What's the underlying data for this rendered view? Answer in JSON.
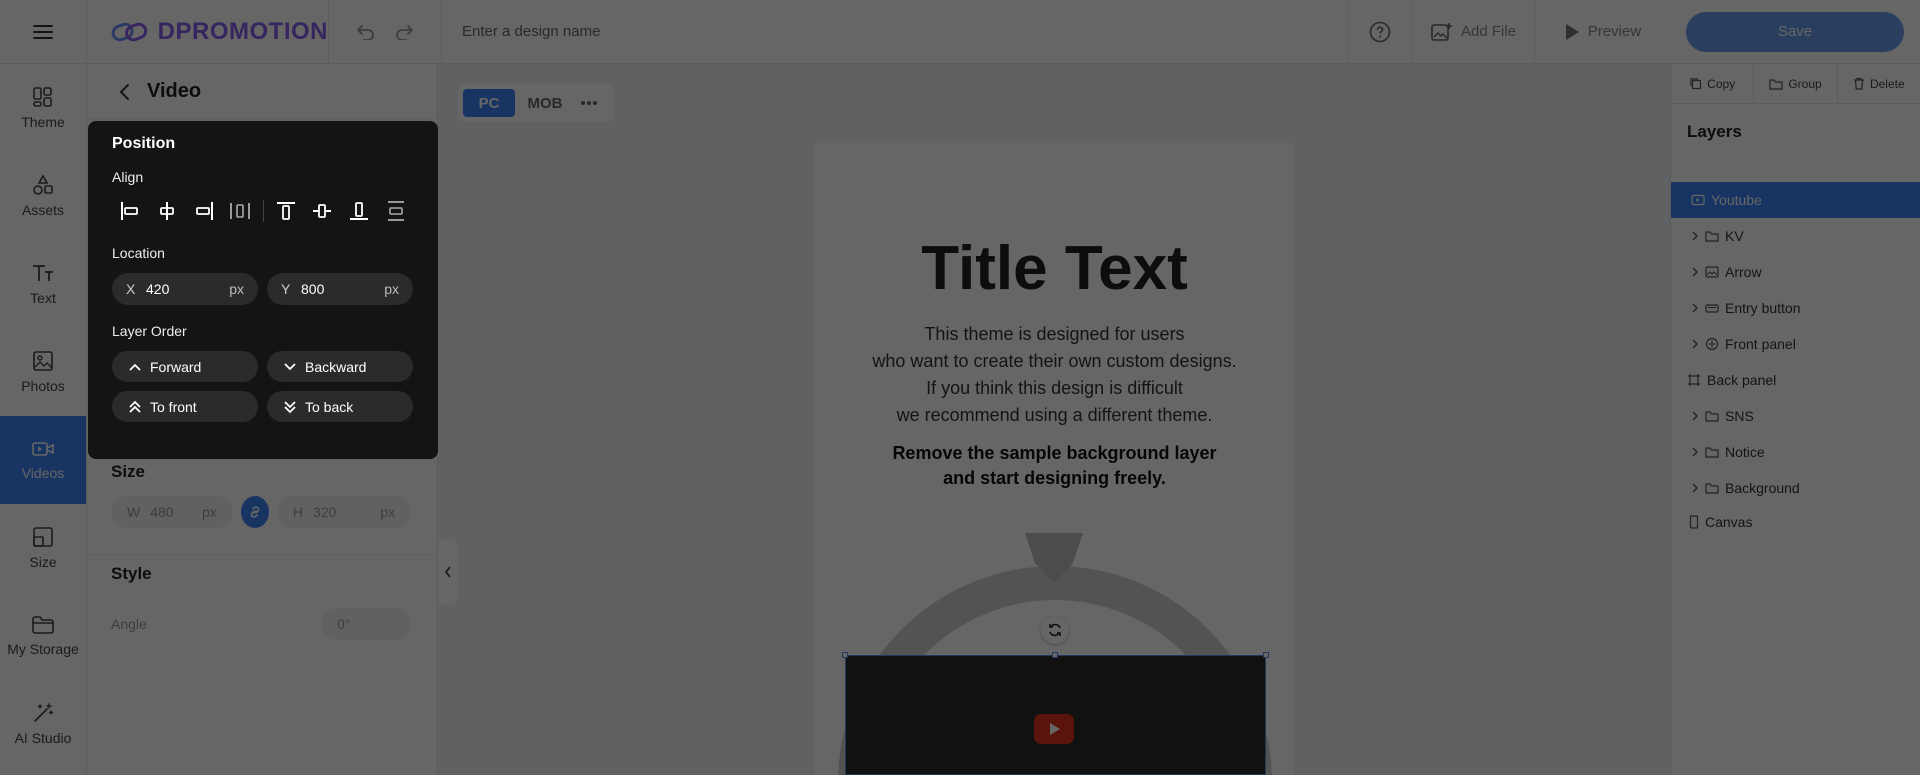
{
  "topbar": {
    "logo_text": "DPROMOTION",
    "design_name_placeholder": "Enter a design name",
    "add_file_label": "Add File",
    "preview_label": "Preview",
    "save_label": "Save"
  },
  "sidebar": {
    "items": [
      {
        "label": "Theme",
        "icon": "theme-icon"
      },
      {
        "label": "Assets",
        "icon": "assets-icon"
      },
      {
        "label": "Text",
        "icon": "text-icon"
      },
      {
        "label": "Photos",
        "icon": "photos-icon"
      },
      {
        "label": "Videos",
        "icon": "videos-icon",
        "active": true
      },
      {
        "label": "Size",
        "icon": "size-icon"
      },
      {
        "label": "My Storage",
        "icon": "folder-icon"
      },
      {
        "label": "AI Studio",
        "icon": "magic-wand-icon"
      }
    ]
  },
  "panel": {
    "title": "Video",
    "position": {
      "title": "Position",
      "align_label": "Align",
      "location_label": "Location",
      "x_axis": "X",
      "x_value": "420",
      "y_axis": "Y",
      "y_value": "800",
      "unit": "px",
      "layer_order_label": "Layer Order",
      "forward": "Forward",
      "backward": "Backward",
      "to_front": "To front",
      "to_back": "To back"
    },
    "size": {
      "title": "Size",
      "w_axis": "W",
      "w_value": "480",
      "h_axis": "H",
      "h_value": "320",
      "unit": "px"
    },
    "style": {
      "title": "Style",
      "angle_label": "Angle",
      "angle_value": "0°"
    }
  },
  "canvas": {
    "tabs": [
      "PC",
      "MOB"
    ],
    "active_tab": "PC",
    "title_text": "Title Text",
    "desc_lines": [
      "This theme is designed for users",
      "who want to create their own custom designs.",
      "If you think this design is difficult",
      "we recommend using a different theme."
    ],
    "bold_lines": [
      "Remove the sample background layer",
      "and start designing freely."
    ]
  },
  "right_panel": {
    "copy_label": "Copy",
    "group_label": "Group",
    "delete_label": "Delete",
    "layers_title": "Layers",
    "layers": [
      {
        "name": "Youtube",
        "icon": "video-icon",
        "active": true,
        "expandable": false
      },
      {
        "name": "KV",
        "icon": "folder-icon",
        "expandable": true
      },
      {
        "name": "Arrow",
        "icon": "image-icon",
        "expandable": true
      },
      {
        "name": "Entry button",
        "icon": "button-icon",
        "expandable": true
      },
      {
        "name": "Front panel",
        "icon": "component-icon",
        "expandable": true
      },
      {
        "name": "Back panel",
        "icon": "frame-icon",
        "expandable": false
      },
      {
        "name": "SNS",
        "icon": "folder-icon",
        "expandable": true
      },
      {
        "name": "Notice",
        "icon": "folder-icon",
        "expandable": true
      },
      {
        "name": "Background",
        "icon": "folder-icon",
        "expandable": true
      },
      {
        "name": "Canvas",
        "icon": "canvas-icon",
        "expandable": false
      }
    ]
  },
  "colors": {
    "accent": "#3b82f6",
    "popup_bg": "#141414",
    "youtube_red": "#e0321c"
  }
}
